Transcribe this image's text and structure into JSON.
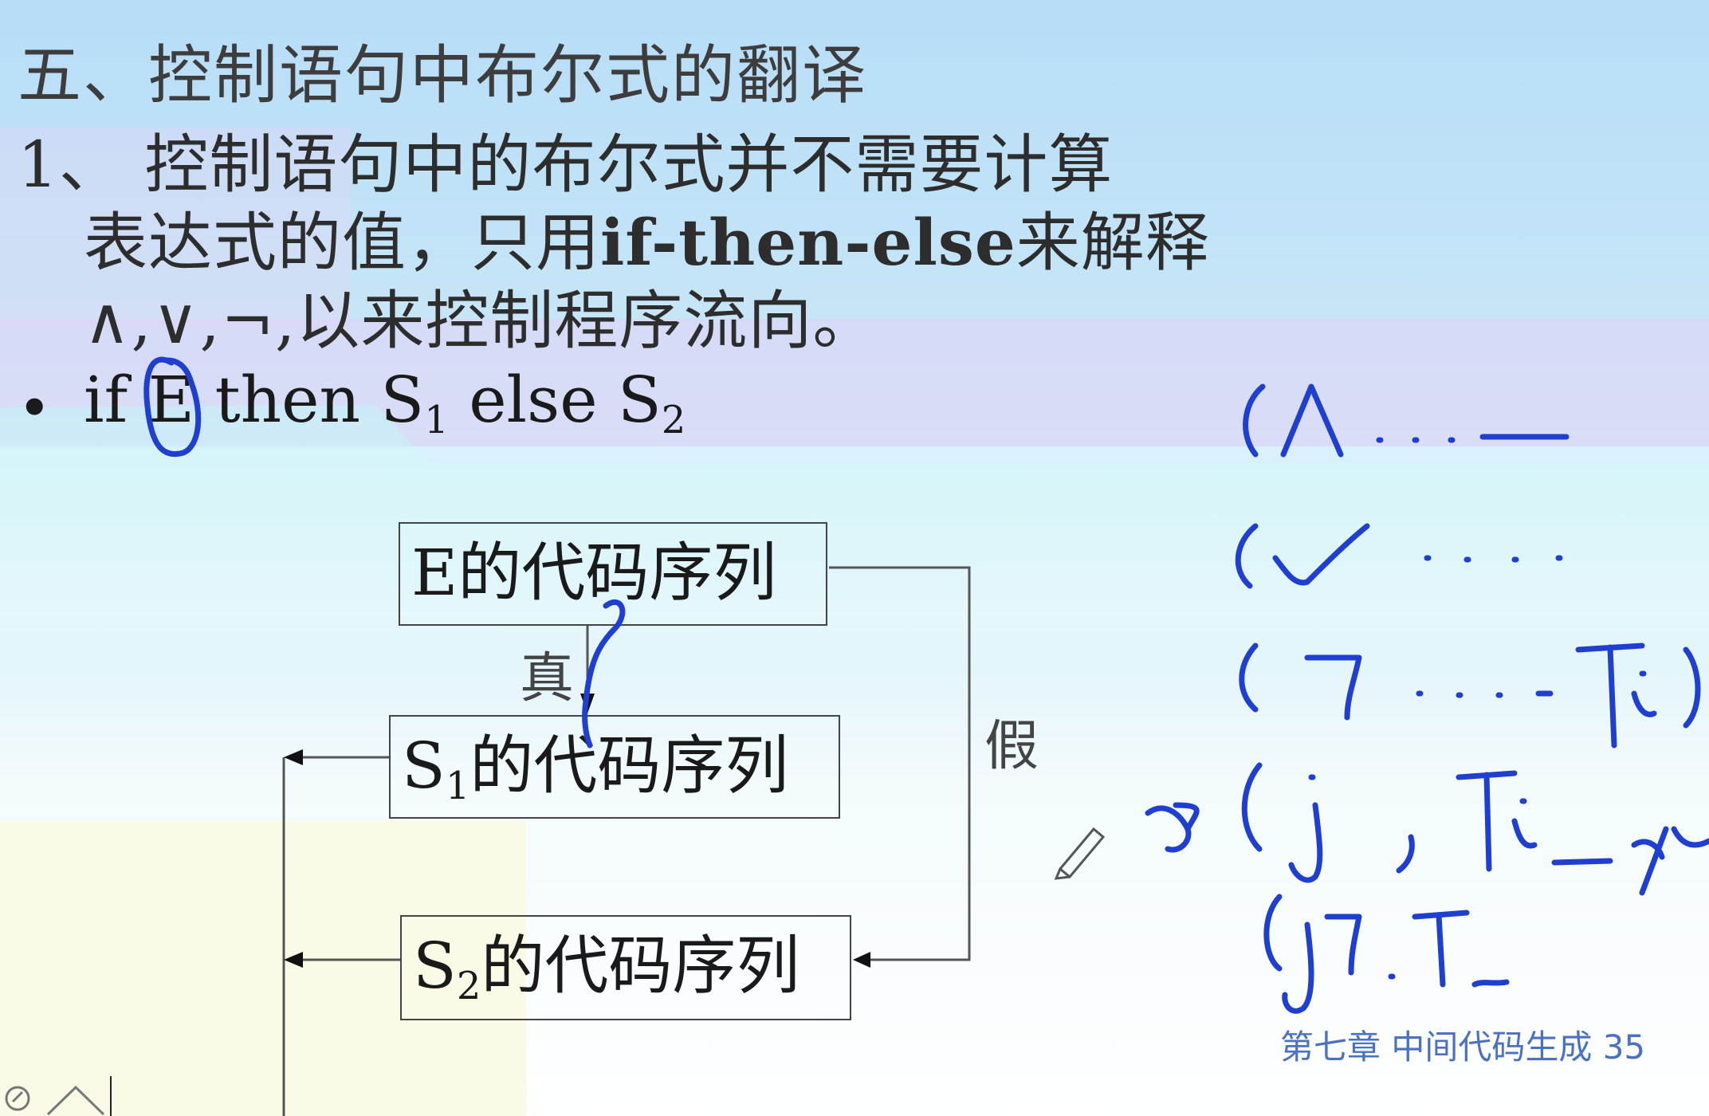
{
  "heading": "五、控制语句中布尔式的翻译",
  "paragraph": {
    "line1": "1、 控制语句中的布尔式并不需要计算",
    "line2_pre": "表达式的值，只用",
    "line2_bold": "if-then-else",
    "line2_post": "来解释",
    "line3": "∧,∨,¬,以来控制程序流向。"
  },
  "bullet": {
    "symbol": "•",
    "text_if": "if E then S",
    "sub_1": "1",
    "text_else": " else S",
    "sub_2": "2"
  },
  "diagram": {
    "box_e": "E的代码序列",
    "box_s1_prefix": "S",
    "box_s1_sub": "1",
    "box_s1_suffix": "的代码序列",
    "box_s2_prefix": "S",
    "box_s2_sub": "2",
    "box_s2_suffix": "的代码序列",
    "label_true": "真",
    "label_false": "假"
  },
  "footer": "第七章  中间代码生成  35",
  "annotation_color": "#1f3fd0"
}
